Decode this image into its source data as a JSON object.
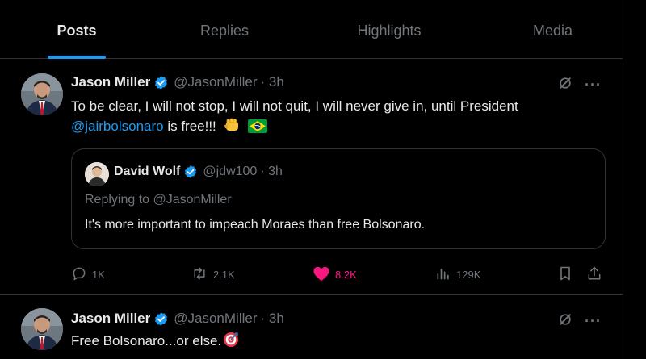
{
  "tabs": [
    {
      "label": "Posts",
      "active": true
    },
    {
      "label": "Replies",
      "active": false
    },
    {
      "label": "Highlights",
      "active": false
    },
    {
      "label": "Media",
      "active": false
    }
  ],
  "posts": [
    {
      "name": "Jason Miller",
      "handle": "@JasonMiller",
      "time": "· 3h",
      "text_before": "To be clear, I will not stop, I will not quit, I will never give in, until President",
      "mention": "@jairbolsonaro",
      "text_after": " is free!!!",
      "emojis": [
        "fist-icon",
        "brazil-flag-icon"
      ],
      "quote": {
        "name": "David Wolf",
        "handle": "@jdw100",
        "time": "· 3h",
        "replying_to": "Replying to @JasonMiller",
        "text": "It's more important to impeach Moraes than free Bolsonaro."
      },
      "actions": {
        "replies": "1K",
        "reposts": "2.1K",
        "likes": "8.2K",
        "views": "129K"
      }
    },
    {
      "name": "Jason Miller",
      "handle": "@JasonMiller",
      "time": "· 3h",
      "text": "Free Bolsonaro...or else.",
      "emojis": [
        "target-icon"
      ]
    }
  ],
  "colors": {
    "accent": "#1d9bf0",
    "like": "#f91880",
    "muted": "#71767b",
    "border": "#2f3336"
  }
}
